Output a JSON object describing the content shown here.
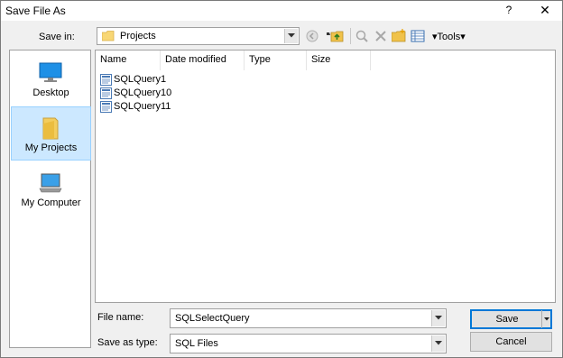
{
  "window": {
    "title": "Save File As",
    "help": "?",
    "close": "✕"
  },
  "save_in": {
    "label": "Save in:",
    "value": "Projects"
  },
  "toolbar": {
    "tools_label": "Tools",
    "icons": [
      "back-icon",
      "up-folder-icon",
      "search-web-icon",
      "delete-icon",
      "new-folder-icon",
      "views-icon"
    ]
  },
  "places": [
    {
      "label": "Desktop",
      "icon": "desktop-icon"
    },
    {
      "label": "My Projects",
      "icon": "folder-icon",
      "selected": true
    },
    {
      "label": "My Computer",
      "icon": "computer-icon"
    }
  ],
  "columns": [
    "Name",
    "Date modified",
    "Type",
    "Size"
  ],
  "files": [
    {
      "name": "SQLQuery1"
    },
    {
      "name": "SQLQuery10"
    },
    {
      "name": "SQLQuery11"
    }
  ],
  "file_name": {
    "label": "File name:",
    "value": "SQLSelectQuery"
  },
  "save_as_type": {
    "label": "Save as type:",
    "value": "SQL Files"
  },
  "buttons": {
    "save": "Save",
    "cancel": "Cancel"
  },
  "colors": {
    "selected_bg": "#cce8ff",
    "accent": "#0078d7"
  }
}
